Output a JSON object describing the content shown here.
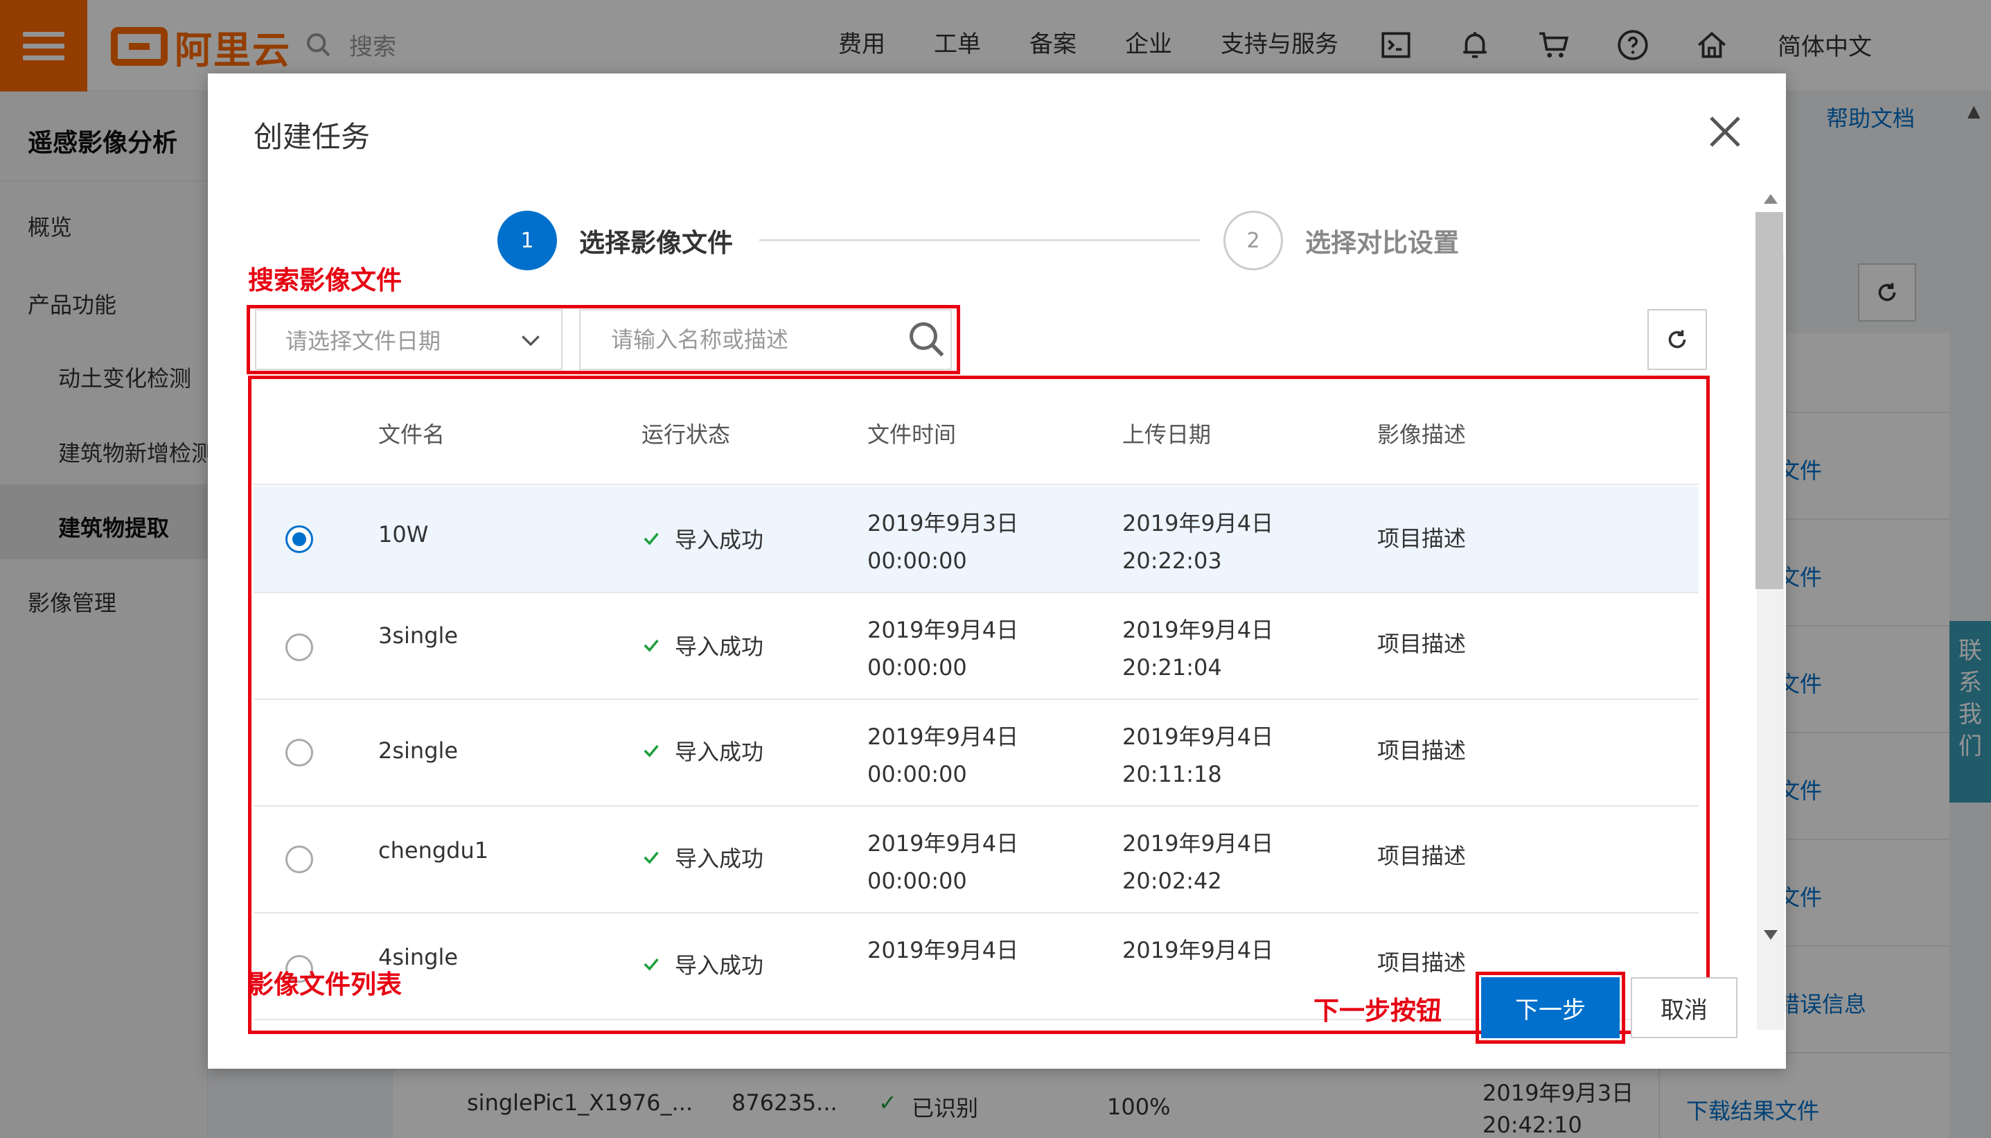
{
  "header": {
    "logo_text": "阿里云",
    "search_placeholder": "搜索",
    "nav": [
      "费用",
      "工单",
      "备案",
      "企业",
      "支持与服务"
    ],
    "icons": [
      "terminal-icon",
      "bell-icon",
      "cart-icon",
      "help-icon",
      "home-icon"
    ],
    "language": "简体中文"
  },
  "sidebar": {
    "title": "遥感影像分析",
    "items": [
      {
        "label": "概览"
      },
      {
        "label": "产品功能"
      },
      {
        "label": "动土变化检测"
      },
      {
        "label": "建筑物新增检测"
      },
      {
        "label": "建筑物提取"
      },
      {
        "label": "影像管理"
      }
    ]
  },
  "background": {
    "help_link": "帮助文档",
    "right_links": [
      "文件",
      "文件",
      "文件",
      "文件",
      "文件",
      "错误信息",
      "下载结果文件"
    ],
    "row": {
      "name": "singlePic1_X1976_...",
      "id": "876235...",
      "status": "已识别",
      "progress": "100%",
      "date": "2019年9月3日",
      "time": "20:42:10"
    },
    "contact": "联系我们"
  },
  "dialog": {
    "title": "创建任务",
    "steps": [
      {
        "number": "1",
        "label": "选择影像文件"
      },
      {
        "number": "2",
        "label": "选择对比设置"
      }
    ],
    "date_select_placeholder": "请选择文件日期",
    "search_placeholder": "请输入名称或描述",
    "columns": [
      "文件名",
      "运行状态",
      "文件时间",
      "上传日期",
      "影像描述"
    ],
    "rows": [
      {
        "name": "10W",
        "status": "导入成功",
        "file_date": "2019年9月3日",
        "file_time": "00:00:00",
        "upload_date": "2019年9月4日",
        "upload_time": "20:22:03",
        "desc": "项目描述",
        "selected": true
      },
      {
        "name": "3single",
        "status": "导入成功",
        "file_date": "2019年9月4日",
        "file_time": "00:00:00",
        "upload_date": "2019年9月4日",
        "upload_time": "20:21:04",
        "desc": "项目描述",
        "selected": false
      },
      {
        "name": "2single",
        "status": "导入成功",
        "file_date": "2019年9月4日",
        "file_time": "00:00:00",
        "upload_date": "2019年9月4日",
        "upload_time": "20:11:18",
        "desc": "项目描述",
        "selected": false
      },
      {
        "name": "chengdu1",
        "status": "导入成功",
        "file_date": "2019年9月4日",
        "file_time": "00:00:00",
        "upload_date": "2019年9月4日",
        "upload_time": "20:02:42",
        "desc": "项目描述",
        "selected": false
      },
      {
        "name": "4single",
        "status": "导入成功",
        "file_date": "2019年9月4日",
        "file_time": "",
        "upload_date": "2019年9月4日",
        "upload_time": "",
        "desc": "项目描述",
        "selected": false
      }
    ],
    "next_label": "下一步",
    "cancel_label": "取消"
  },
  "annotations": {
    "search_files": "搜索影像文件",
    "file_list": "影像文件列表",
    "next_button": "下一步按钮"
  },
  "colors": {
    "brand": "#ff6a00",
    "primary": "#0070cc",
    "annotation": "#e60012",
    "success": "#1e9e3e"
  }
}
